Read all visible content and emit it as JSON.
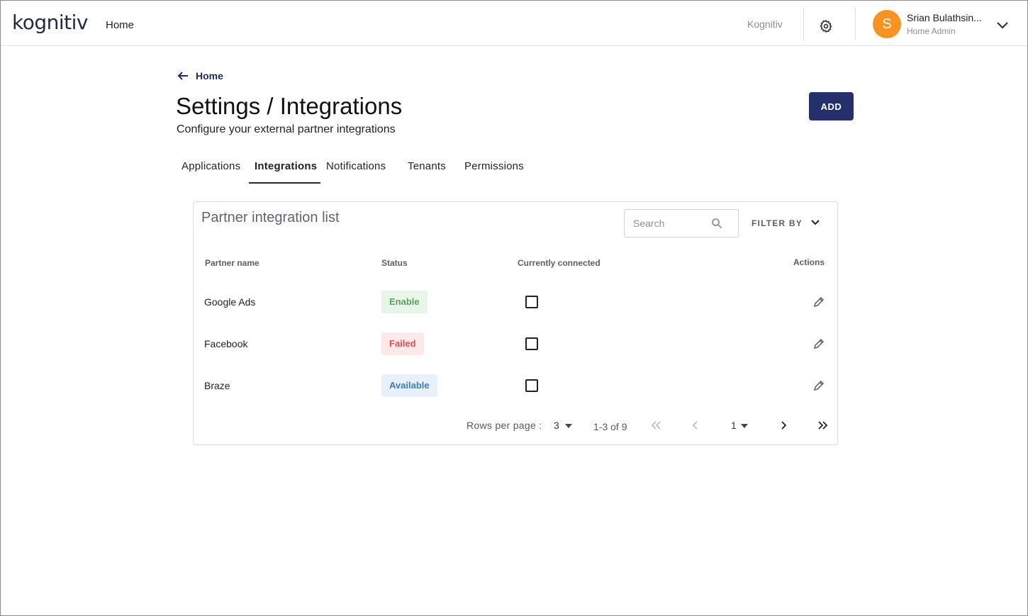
{
  "header": {
    "logo_text": "kognitiv",
    "nav_home": "Home",
    "brand_link": "Kognitiv",
    "user": {
      "initial": "S",
      "name": "Srian Bulathsin...",
      "role": "Home Admin"
    }
  },
  "page": {
    "back_label": "Home",
    "title": "Settings / Integrations",
    "subtitle": "Configure your external partner integrations",
    "add_label": "ADD"
  },
  "tabs": [
    {
      "label": "Applications",
      "active": false
    },
    {
      "label": "Integrations",
      "active": true
    },
    {
      "label": "Notifications",
      "active": false
    },
    {
      "label": "Tenants",
      "active": false
    },
    {
      "label": "Permissions",
      "active": false
    }
  ],
  "card": {
    "title": "Partner integration list",
    "search_placeholder": "Search",
    "filter_label": "FILTER BY",
    "columns": {
      "partner": "Partner name",
      "status": "Status",
      "connected": "Currently connected",
      "actions": "Actions"
    },
    "rows": [
      {
        "name": "Google Ads",
        "status": "Enable",
        "connected": false
      },
      {
        "name": "Facebook",
        "status": "Failed",
        "connected": false
      },
      {
        "name": "Braze",
        "status": "Available",
        "connected": false
      }
    ],
    "pagination": {
      "rows_label": "Rows per page :",
      "rows_value": "3",
      "range": "1-3 of 9",
      "page": "1"
    }
  },
  "colors": {
    "accent_dark": "#24306b",
    "logo_teal": "#17b3b0",
    "avatar": "#f7931e",
    "enable": "#5aa35c",
    "failed": "#d2504f",
    "available": "#3b7bc0"
  }
}
